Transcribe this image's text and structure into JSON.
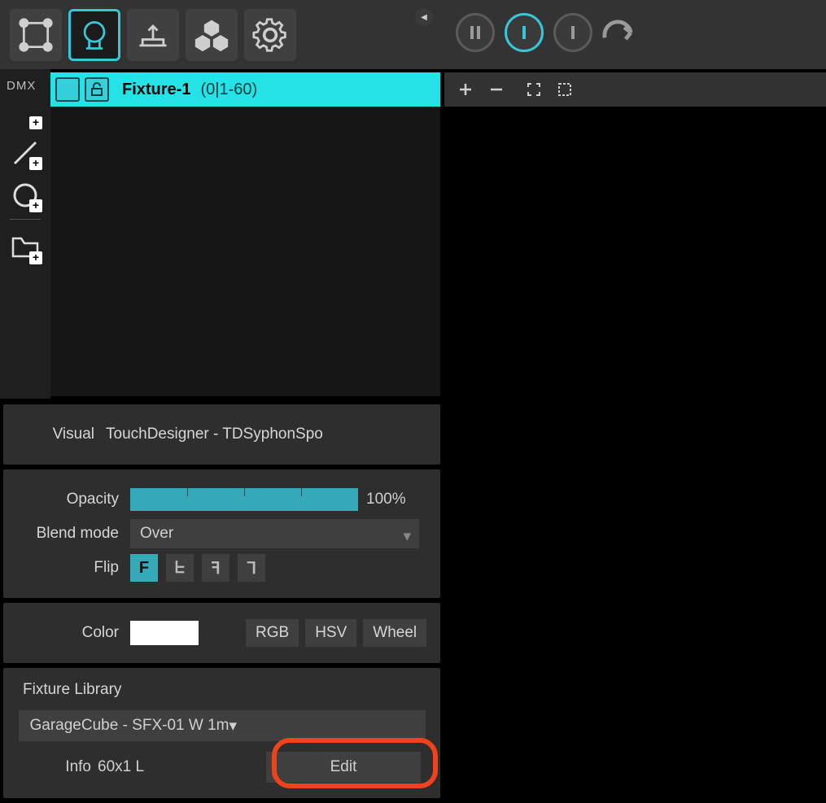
{
  "sidebar": {
    "dmx_label": "DMX"
  },
  "fixture": {
    "name": "Fixture-1",
    "range": "(0|1-60)"
  },
  "visual": {
    "label": "Visual",
    "value": "TouchDesigner - TDSyphonSpo"
  },
  "opacity": {
    "label": "Opacity",
    "percent": "100%"
  },
  "blend": {
    "label": "Blend mode",
    "value": "Over"
  },
  "flip": {
    "label": "Flip",
    "glyphs": [
      "F",
      "ᖶ",
      "ꟻ",
      "ᒣ"
    ]
  },
  "color": {
    "label": "Color",
    "swatch": "#ffffff",
    "modes": [
      "RGB",
      "HSV",
      "Wheel"
    ]
  },
  "library": {
    "title": "Fixture Library",
    "selected": "GarageCube - SFX-01 W 1m",
    "info_label": "Info",
    "info_value": "60x1 L",
    "edit_label": "Edit"
  }
}
